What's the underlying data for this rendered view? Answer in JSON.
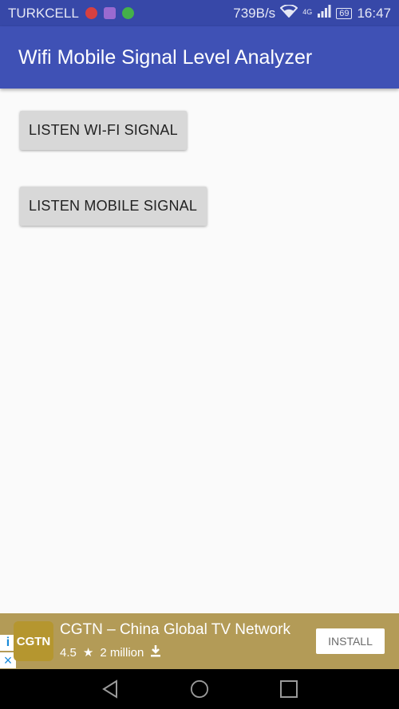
{
  "status_bar": {
    "carrier": "TURKCELL",
    "speed": "739B/s",
    "network": "4G",
    "battery": "69",
    "time": "16:47"
  },
  "app_bar": {
    "title": "Wifi Mobile Signal Level Analyzer"
  },
  "main": {
    "wifi_button": "LISTEN WI-FI SIGNAL",
    "mobile_button": "LISTEN MOBILE SIGNAL"
  },
  "ad": {
    "logo": "CGTN",
    "title": "CGTN – China Global TV Network",
    "rating": "4.5",
    "downloads": "2 million",
    "install": "INSTALL",
    "info_icon": "i",
    "close_icon": "×"
  },
  "nav_bar": {
    "icons": [
      "back-icon",
      "home-icon",
      "recents-icon"
    ]
  },
  "colors": {
    "app_bar": "#3f51b5",
    "status_bar": "#3748a8",
    "ad_background": "#b39b57",
    "button": "#d8d8d8"
  }
}
